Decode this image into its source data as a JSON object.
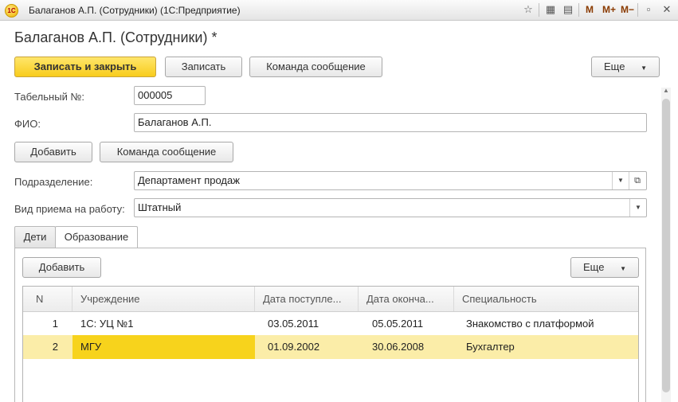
{
  "window": {
    "title": "Балаганов А.П. (Сотрудники)  (1С:Предприятие)",
    "logo": "1С",
    "toolbar": {
      "m": "M",
      "m_plus": "M+",
      "m_minus": "M−"
    },
    "icons": [
      "star-icon",
      "calculator-icon",
      "calendar-icon",
      "minimize-icon",
      "maximize-icon",
      "close-icon"
    ]
  },
  "page": {
    "title": "Балаганов А.П. (Сотрудники) *"
  },
  "commands": {
    "save_close": "Записать и закрыть",
    "save": "Записать",
    "message": "Команда сообщение",
    "more": "Еще"
  },
  "form": {
    "tab_number_label": "Табельный №:",
    "tab_number_value": "000005",
    "fio_label": "ФИО:",
    "fio_value": "Балаганов А.П.",
    "add_button": "Добавить",
    "message_button": "Команда сообщение",
    "department_label": "Подразделение:",
    "department_value": "Департамент продаж",
    "hire_type_label": "Вид приема на работу:",
    "hire_type_value": "Штатный"
  },
  "tabs": [
    {
      "label": "Дети",
      "active": false
    },
    {
      "label": "Образование",
      "active": true
    }
  ],
  "education": {
    "add_button": "Добавить",
    "more_button": "Еще",
    "columns": [
      "N",
      "Учреждение",
      "Дата поступле...",
      "Дата оконча...",
      "Специальность"
    ],
    "rows": [
      {
        "n": "1",
        "institution": "1С: УЦ №1",
        "start": "03.05.2011",
        "end": "05.05.2011",
        "specialty": "Знакомство с платформой",
        "selected": false
      },
      {
        "n": "2",
        "institution": "МГУ",
        "start": "01.09.2002",
        "end": "30.06.2008",
        "specialty": "Бухгалтер",
        "selected": true
      }
    ]
  },
  "colors": {
    "accent": "#f8cc1c",
    "selected_row": "#fbeda8",
    "selected_cell": "#f7d31c"
  }
}
